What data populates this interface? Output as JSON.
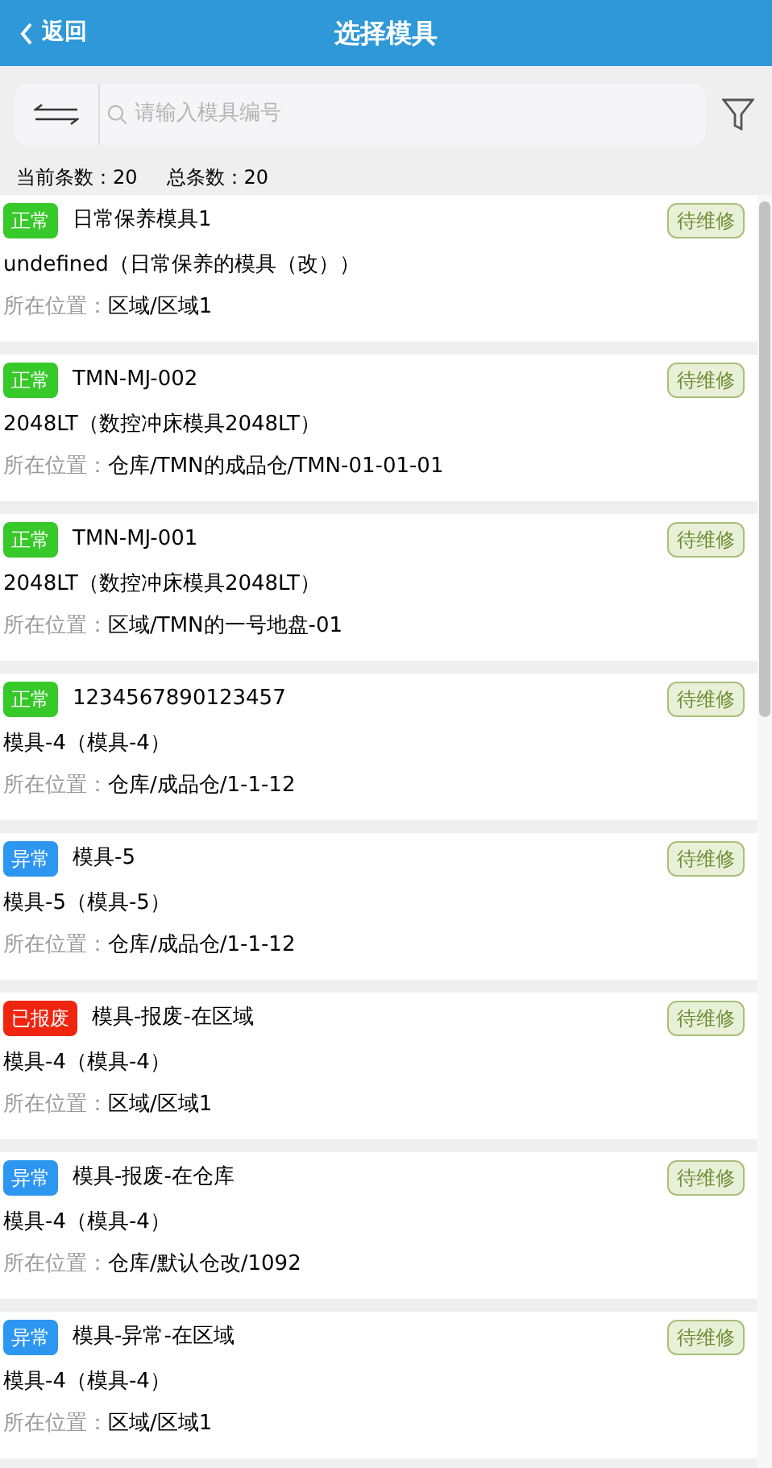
{
  "header": {
    "back": "返回",
    "title": "选择模具"
  },
  "search": {
    "placeholder": "请输入模具编号"
  },
  "counts": {
    "current_label": "当前条数：",
    "current": "20",
    "total_label": "总条数：",
    "total": "20"
  },
  "items": [
    {
      "status": "正常",
      "color": "#37c92a",
      "name": "日常保养模具1",
      "tag": "待维修",
      "desc": "undefined（日常保养的模具（改））",
      "location_label": "所在位置：",
      "location": "区域/区域1"
    },
    {
      "status": "正常",
      "color": "#37c92a",
      "name": "TMN-MJ-002",
      "tag": "待维修",
      "desc": "2048LT（数控冲床模具2048LT）",
      "location_label": "所在位置：",
      "location": "仓库/TMN的成品仓/TMN-01-01-01"
    },
    {
      "status": "正常",
      "color": "#37c92a",
      "name": "TMN-MJ-001",
      "tag": "待维修",
      "desc": "2048LT（数控冲床模具2048LT）",
      "location_label": "所在位置：",
      "location": "区域/TMN的一号地盘-01"
    },
    {
      "status": "正常",
      "color": "#37c92a",
      "name": "1234567890123457",
      "tag": "待维修",
      "desc": "模具-4（模具-4）",
      "location_label": "所在位置：",
      "location": "仓库/成品仓/1-1-12"
    },
    {
      "status": "异常",
      "color": "#2d96f0",
      "name": "模具-5",
      "tag": "待维修",
      "desc": "模具-5（模具-5）",
      "location_label": "所在位置：",
      "location": "仓库/成品仓/1-1-12"
    },
    {
      "status": "已报废",
      "color": "#f0250f",
      "name": "模具-报废-在区域",
      "tag": "待维修",
      "desc": "模具-4（模具-4）",
      "location_label": "所在位置：",
      "location": "区域/区域1"
    },
    {
      "status": "异常",
      "color": "#2d96f0",
      "name": "模具-报废-在仓库",
      "tag": "待维修",
      "desc": "模具-4（模具-4）",
      "location_label": "所在位置：",
      "location": "仓库/默认仓改/1092"
    },
    {
      "status": "异常",
      "color": "#2d96f0",
      "name": "模具-异常-在区域",
      "tag": "待维修",
      "desc": "模具-4（模具-4）",
      "location_label": "所在位置：",
      "location": "区域/区域1"
    }
  ]
}
